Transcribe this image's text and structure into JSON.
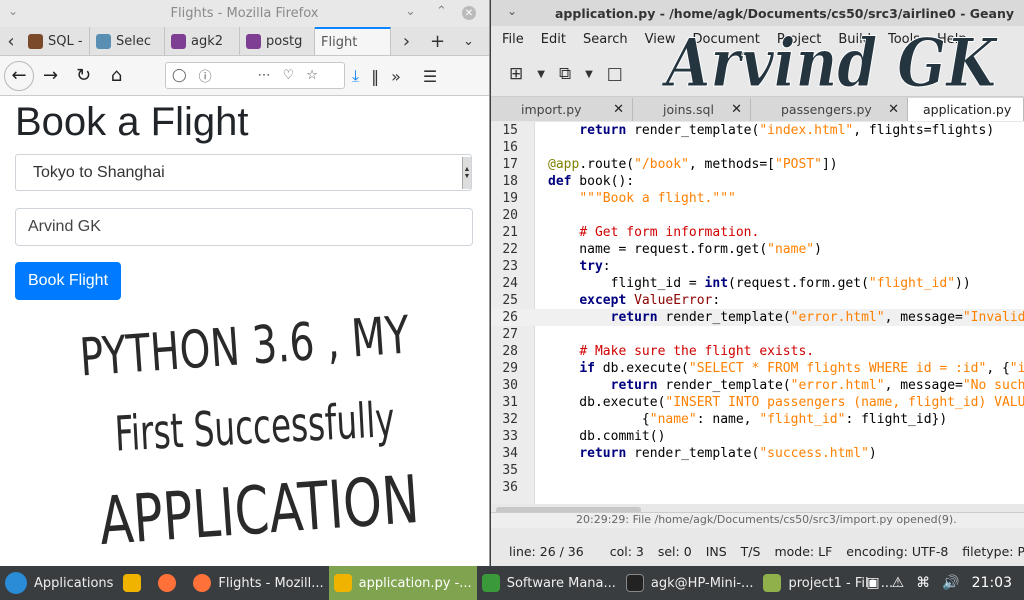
{
  "firefox": {
    "window_title": "Flights - Mozilla Firefox",
    "tabs": [
      {
        "label": "SQL -",
        "color": "#7a4a2a"
      },
      {
        "label": "Selec",
        "color": "#5a8fb4"
      },
      {
        "label": "agk2",
        "color": "#7e3f92"
      },
      {
        "label": "postg",
        "color": "#7e3f92"
      },
      {
        "label": "Flight",
        "color": "#ffffff"
      }
    ],
    "page": {
      "heading": "Book a Flight",
      "selected_flight": "Tokyo to Shanghai",
      "name_value": "Arvind GK",
      "button_label": "Book Flight",
      "handwriting": [
        "PYTHON 3.6 , MY",
        "First Successfully",
        "APPLICATION"
      ]
    }
  },
  "geany": {
    "window_title": "application.py - /home/agk/Documents/cs50/src3/airline0 - Geany",
    "menu": [
      "File",
      "Edit",
      "Search",
      "View",
      "Document",
      "Project",
      "Build",
      "Tools",
      "Help"
    ],
    "tabs": [
      "import.py",
      "joins.sql",
      "passengers.py",
      "application.py"
    ],
    "active_tab": "application.py",
    "message": "20:29:29: File /home/agk/Documents/cs50/src3/import.py opened(9).",
    "status": {
      "line": "line: 26 / 36",
      "col": "col: 3",
      "sel": "sel: 0",
      "ins": "INS",
      "ts": "T/S",
      "mode": "mode: LF",
      "encoding": "encoding: UTF-8",
      "filetype": "filetype: P"
    }
  },
  "watermark": "Arvind GK",
  "taskbar": {
    "apps_label": "Applications",
    "items": [
      "Flights - Mozill...",
      "application.py -...",
      "Software Mana...",
      "agk@HP-Mini-...",
      "project1 - File ..."
    ],
    "clock": "21:03"
  }
}
